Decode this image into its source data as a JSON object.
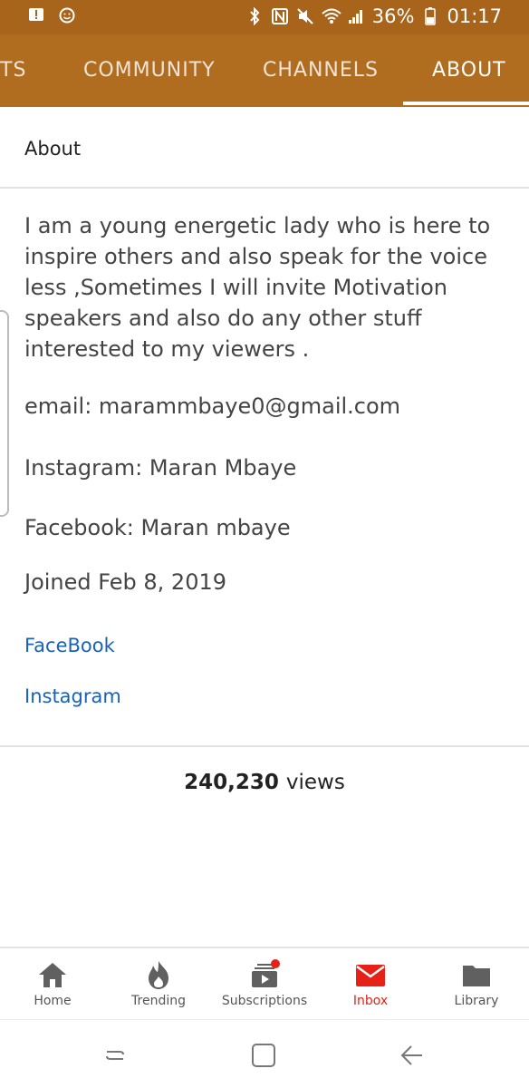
{
  "status_bar": {
    "battery": "36%",
    "time": "01:17"
  },
  "tabs": [
    {
      "label": "TS"
    },
    {
      "label": "COMMUNITY"
    },
    {
      "label": "CHANNELS"
    },
    {
      "label": "ABOUT"
    }
  ],
  "about": {
    "heading": "About",
    "description_lines": [
      "I am a young energetic lady who is here to",
      "inspire others and also speak for the voice",
      "less ,Sometimes I will invite Motivation",
      "speakers and also do any other stuff",
      "interested to my viewers ."
    ],
    "email": "email: marammbaye0@gmail.com",
    "instagram": "Instagram: Maran Mbaye",
    "facebook": "Facebook: Maran mbaye",
    "joined": "Joined Feb 8, 2019",
    "links": [
      {
        "label": "FaceBook"
      },
      {
        "label": "Instagram"
      }
    ],
    "views_number": "240,230",
    "views_label": "views"
  },
  "bottom_nav": [
    {
      "label": "Home",
      "icon": "home-icon"
    },
    {
      "label": "Trending",
      "icon": "flame-icon"
    },
    {
      "label": "Subscriptions",
      "icon": "subscriptions-icon"
    },
    {
      "label": "Inbox",
      "icon": "mail-icon"
    },
    {
      "label": "Library",
      "icon": "folder-icon"
    }
  ],
  "colors": {
    "header": "#b06c1f",
    "status_bar": "#a8641b",
    "link": "#1a62b8",
    "active": "#e62117"
  }
}
